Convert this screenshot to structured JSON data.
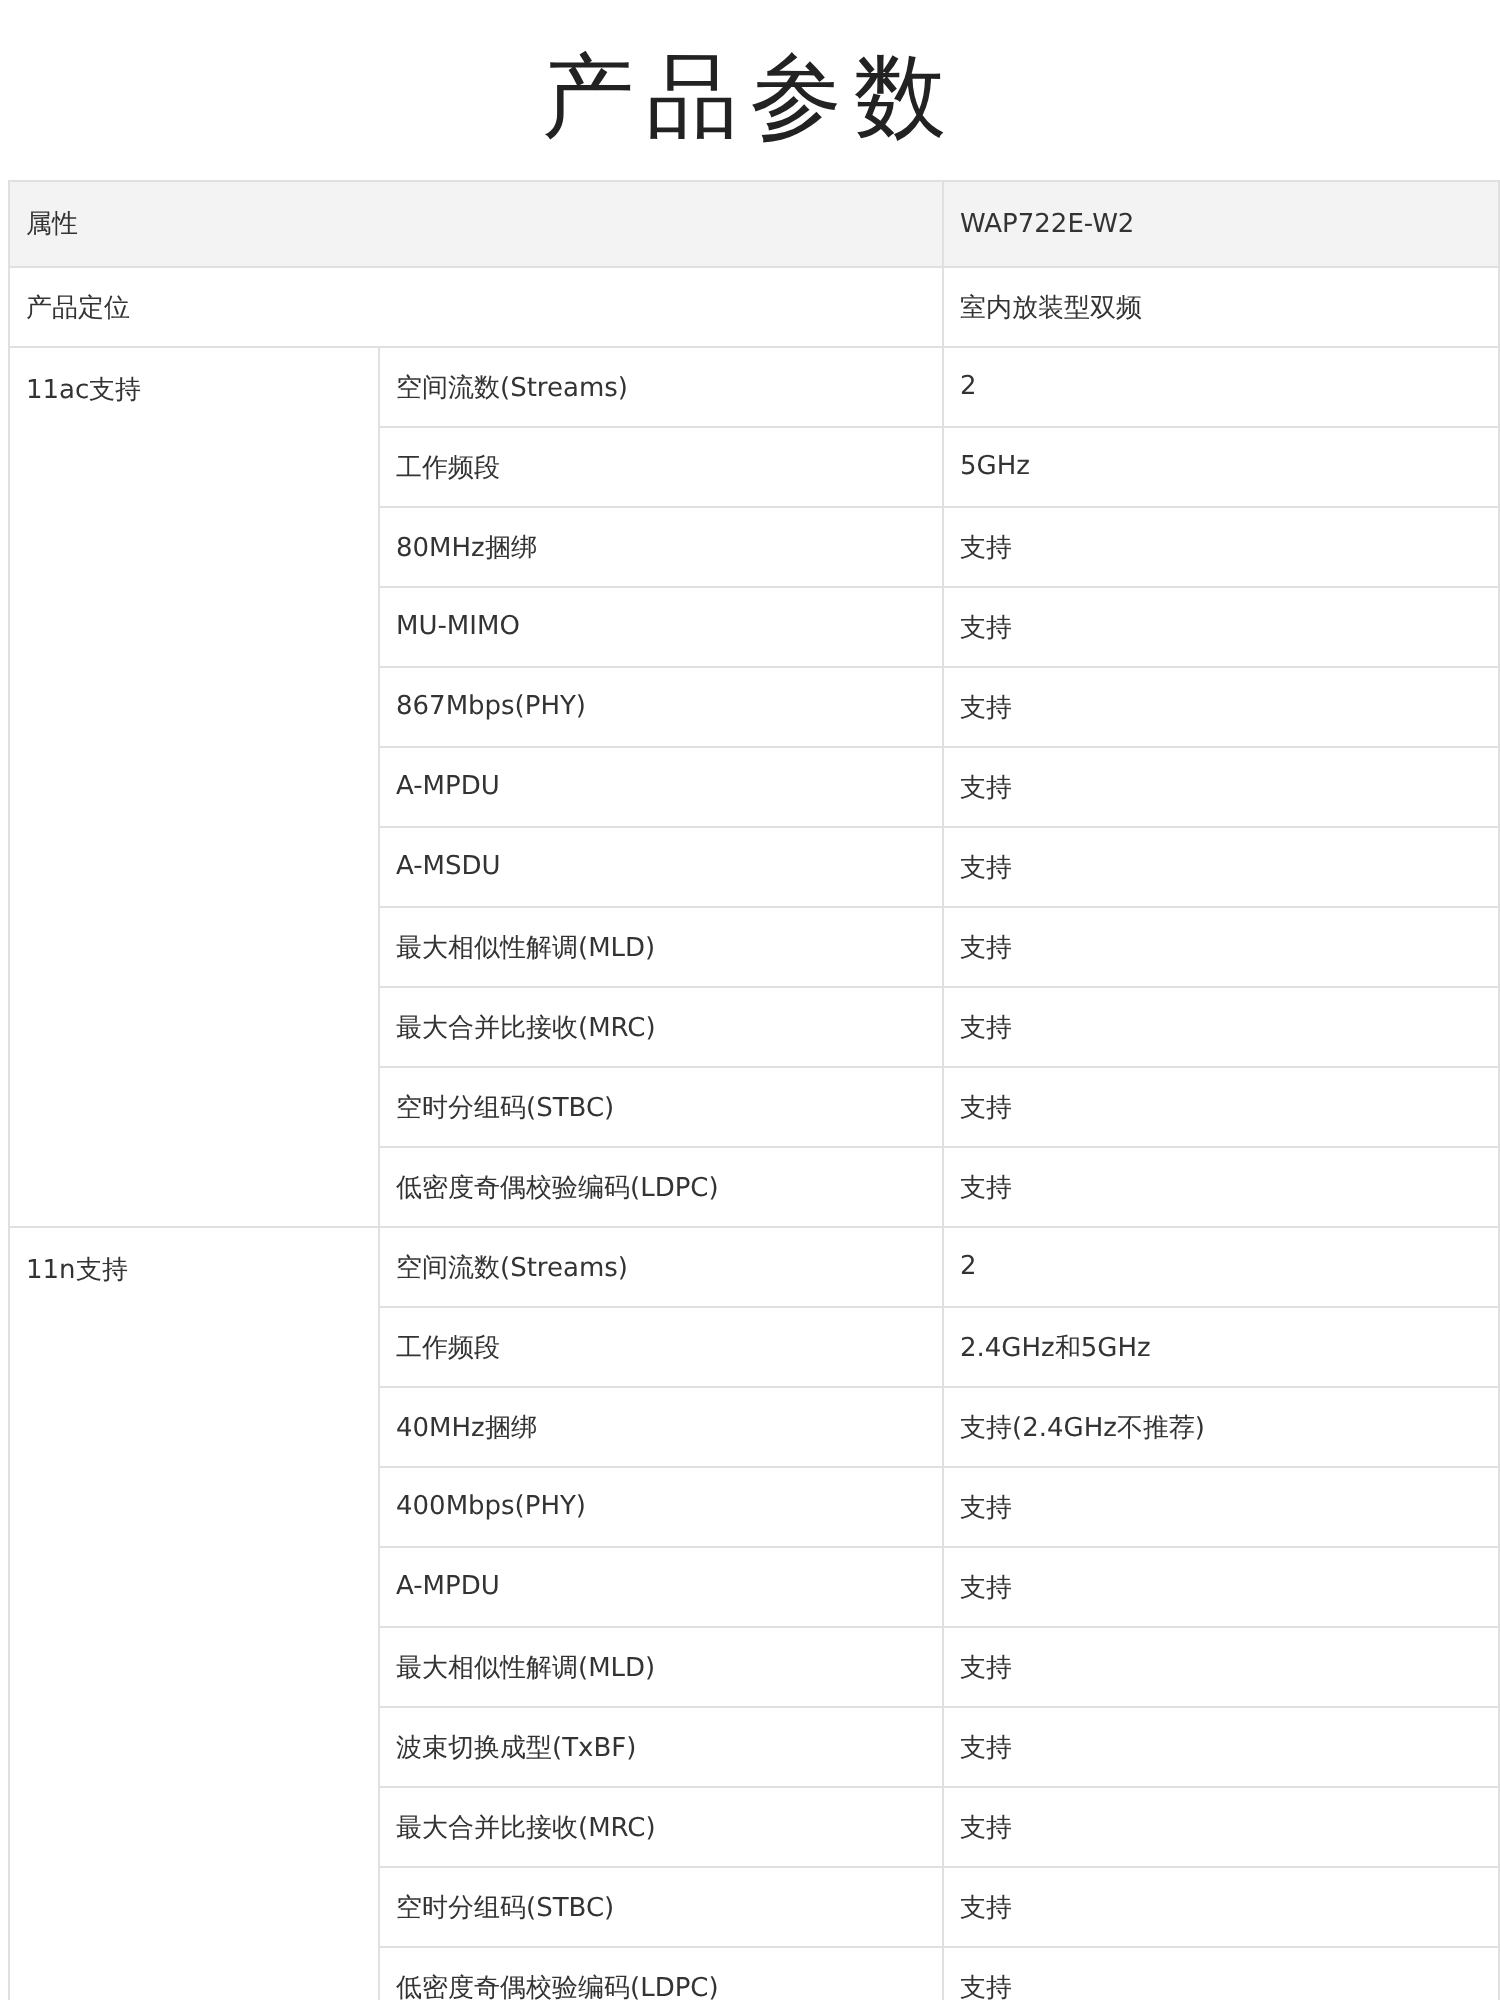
{
  "title": "产品参数",
  "table": {
    "header": {
      "attribute": "属性",
      "model": "WAP722E-W2"
    },
    "positioning": {
      "label": "产品定位",
      "value": "室内放装型双频"
    },
    "groups": [
      {
        "label": "11ac支持",
        "rows": [
          {
            "feature": "空间流数(Streams)",
            "value": "2"
          },
          {
            "feature": "工作频段",
            "value": "5GHz"
          },
          {
            "feature": "80MHz捆绑",
            "value": "支持"
          },
          {
            "feature": "MU-MIMO",
            "value": "支持"
          },
          {
            "feature": "867Mbps(PHY)",
            "value": "支持"
          },
          {
            "feature": "A-MPDU",
            "value": "支持"
          },
          {
            "feature": "A-MSDU",
            "value": "支持"
          },
          {
            "feature": "最大相似性解调(MLD)",
            "value": "支持"
          },
          {
            "feature": "最大合并比接收(MRC)",
            "value": "支持"
          },
          {
            "feature": "空时分组码(STBC)",
            "value": "支持"
          },
          {
            "feature": "低密度奇偶校验编码(LDPC)",
            "value": "支持"
          }
        ]
      },
      {
        "label": "11n支持",
        "rows": [
          {
            "feature": "空间流数(Streams)",
            "value": "2"
          },
          {
            "feature": "工作频段",
            "value": "2.4GHz和5GHz"
          },
          {
            "feature": "40MHz捆绑",
            "value": "支持(2.4GHz不推荐)"
          },
          {
            "feature": "400Mbps(PHY)",
            "value": "支持"
          },
          {
            "feature": "A-MPDU",
            "value": "支持"
          },
          {
            "feature": "最大相似性解调(MLD)",
            "value": "支持"
          },
          {
            "feature": "波束切换成型(TxBF)",
            "value": "支持"
          },
          {
            "feature": "最大合并比接收(MRC)",
            "value": "支持"
          },
          {
            "feature": "空时分组码(STBC)",
            "value": "支持"
          },
          {
            "feature": "低密度奇偶校验编码(LDPC)",
            "value": "支持"
          }
        ]
      }
    ]
  }
}
